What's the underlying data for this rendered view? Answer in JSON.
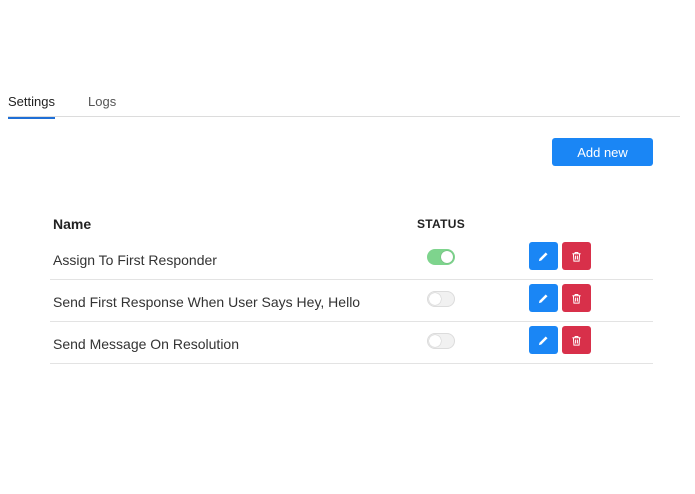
{
  "tabs": [
    {
      "label": "Settings",
      "active": true
    },
    {
      "label": "Logs",
      "active": false
    }
  ],
  "toolbar": {
    "add_label": "Add new"
  },
  "table": {
    "headers": {
      "name": "Name",
      "status": "STATUS"
    },
    "rows": [
      {
        "name": "Assign To First Responder",
        "status_enabled": true
      },
      {
        "name": "Send First Response When User Says Hey, Hello",
        "status_enabled": false
      },
      {
        "name": "Send Message On Resolution",
        "status_enabled": false
      }
    ]
  },
  "icons": {
    "edit": "pencil-icon",
    "delete": "trash-icon"
  },
  "colors": {
    "accent": "#1a86f5",
    "danger": "#d8304a",
    "toggle_on": "#7ed48d",
    "tab_underline": "#1f6fd6"
  }
}
